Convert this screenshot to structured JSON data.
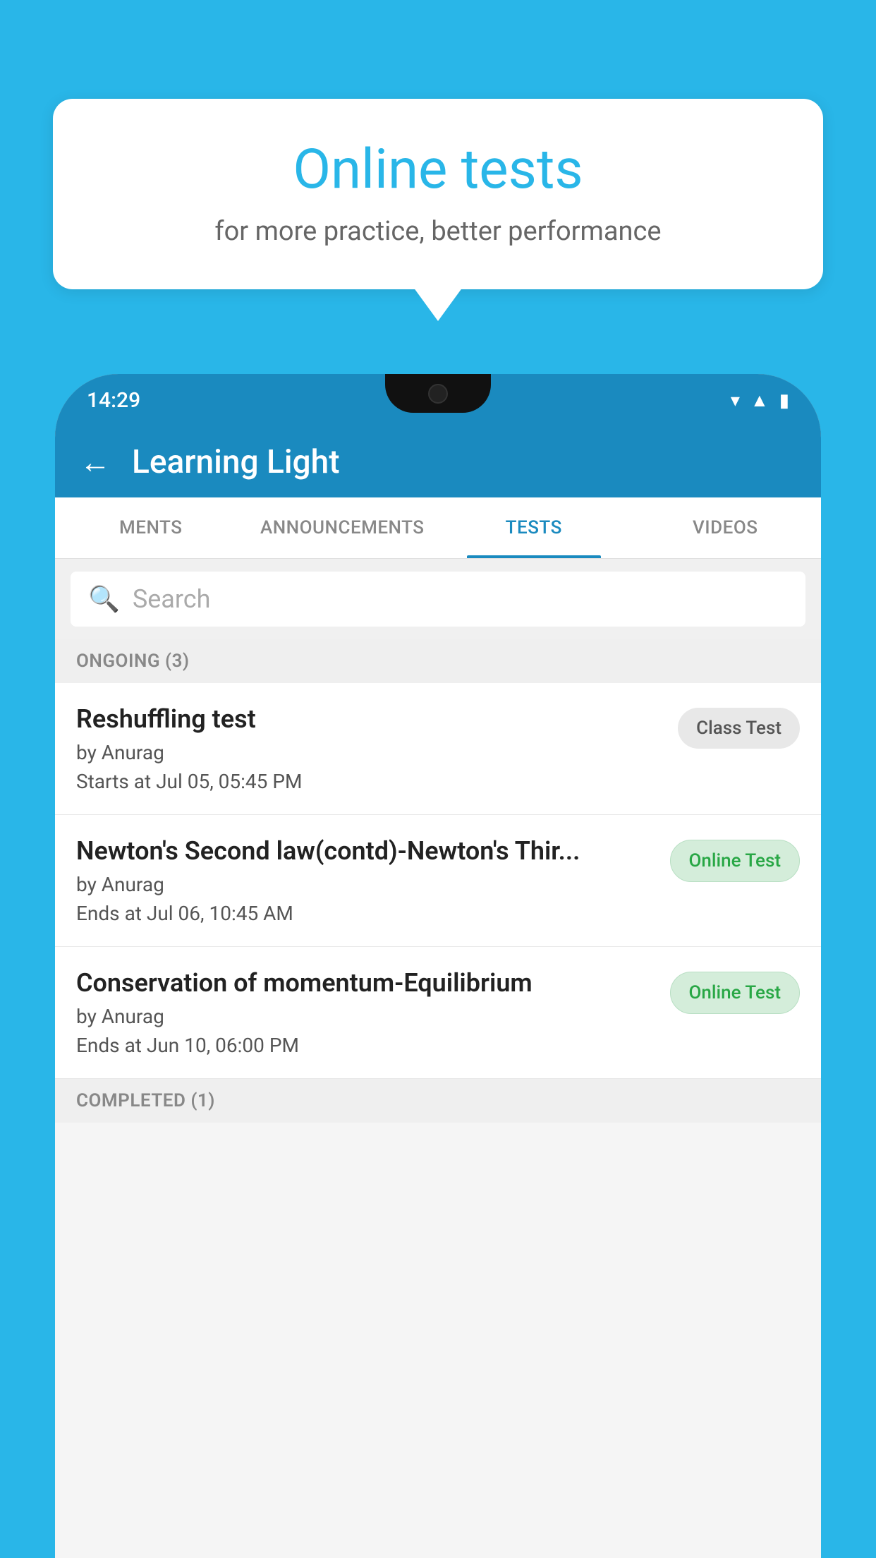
{
  "bubble": {
    "title": "Online tests",
    "subtitle": "for more practice, better performance"
  },
  "phone": {
    "status_time": "14:29",
    "app_title": "Learning Light",
    "back_label": "←"
  },
  "tabs": [
    {
      "id": "ments",
      "label": "MENTS",
      "active": false
    },
    {
      "id": "announcements",
      "label": "ANNOUNCEMENTS",
      "active": false
    },
    {
      "id": "tests",
      "label": "TESTS",
      "active": true
    },
    {
      "id": "videos",
      "label": "VIDEOS",
      "active": false
    }
  ],
  "search": {
    "placeholder": "Search"
  },
  "ongoing_section": {
    "label": "ONGOING (3)"
  },
  "tests": [
    {
      "id": "test-1",
      "name": "Reshuffling test",
      "author": "by Anurag",
      "date_label": "Starts at",
      "date": "Jul 05, 05:45 PM",
      "badge": "Class Test",
      "badge_type": "class"
    },
    {
      "id": "test-2",
      "name": "Newton's Second law(contd)-Newton's Thir...",
      "author": "by Anurag",
      "date_label": "Ends at",
      "date": "Jul 06, 10:45 AM",
      "badge": "Online Test",
      "badge_type": "online"
    },
    {
      "id": "test-3",
      "name": "Conservation of momentum-Equilibrium",
      "author": "by Anurag",
      "date_label": "Ends at",
      "date": "Jun 10, 06:00 PM",
      "badge": "Online Test",
      "badge_type": "online"
    }
  ],
  "completed_section": {
    "label": "COMPLETED (1)"
  },
  "colors": {
    "primary": "#1a8abf",
    "background": "#29b6e8",
    "badge_class_bg": "#e8e8e8",
    "badge_online_bg": "#d4edda",
    "badge_online_text": "#28a745"
  }
}
